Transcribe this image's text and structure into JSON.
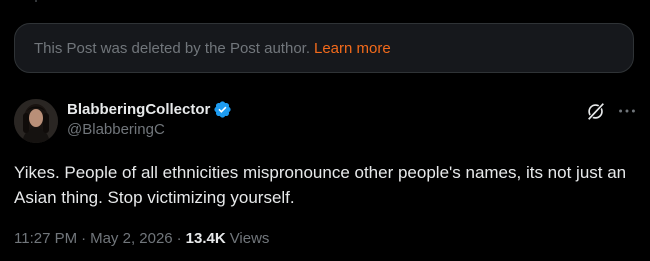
{
  "deleted_notice": {
    "text": "This Post was deleted by the Post author.",
    "link_label": "Learn more"
  },
  "author": {
    "display_name": "BlabberingCollector",
    "handle": "@BlabberingC",
    "verified": true,
    "avatar_icon": "profile-photo"
  },
  "tweet": {
    "text": "Yikes. People of all ethnicities mispronounce other people's names, its not just an Asian thing. Stop victimizing yourself."
  },
  "meta": {
    "time": "11:27 PM",
    "date": "May 2, 2026",
    "separator": "·",
    "views_count": "13.4K",
    "views_label": "Views"
  },
  "icons": {
    "grok": "grok-icon",
    "more": "more-icon",
    "verified": "verified-badge-icon"
  },
  "colors": {
    "background": "#000000",
    "text_primary": "#e7e9ea",
    "text_secondary": "#71767b",
    "link_accent": "#f26a1b",
    "verified_blue": "#1d9bf0",
    "card_background": "#16181c",
    "border": "#2f3336"
  }
}
